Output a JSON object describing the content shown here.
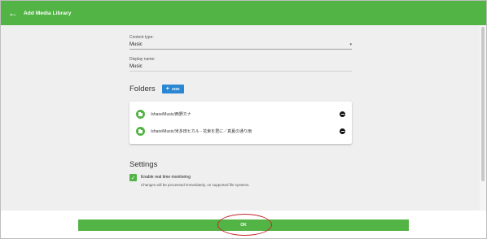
{
  "header": {
    "title": "Add Media Library",
    "back_icon": "arrow-left-icon"
  },
  "form": {
    "content_type": {
      "label": "Content type:",
      "value": "Music"
    },
    "display_name": {
      "label": "Display name:",
      "value": "Music"
    }
  },
  "folders": {
    "title": "Folders",
    "add_label": "ADD",
    "items": [
      {
        "path": "/share/Music/西野カナ"
      },
      {
        "path": "/share/Music/米多田ヒカル - 花束を君に／真夏の通り雨"
      }
    ]
  },
  "settings": {
    "title": "Settings",
    "realtime": {
      "label": "Enable real time monitoring",
      "help": "Changes will be processed immediately, on supported file systems.",
      "checked": true
    }
  },
  "footer": {
    "ok_label": "OK"
  },
  "colors": {
    "brand": "#53b446",
    "add_button": "#2b87d3",
    "annotation": "#c62828"
  }
}
